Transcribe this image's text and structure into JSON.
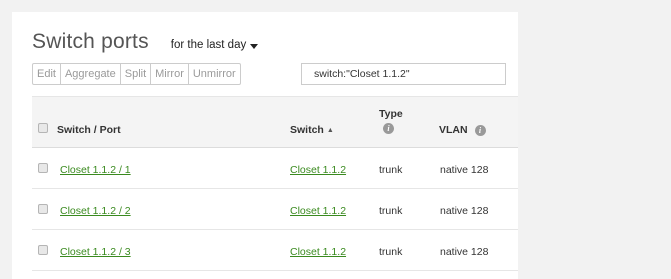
{
  "page": {
    "title": "Switch ports",
    "timespan": "for the last day"
  },
  "toolbar": {
    "buttons": [
      "Edit",
      "Aggregate",
      "Split",
      "Mirror",
      "Unmirror"
    ]
  },
  "search": {
    "value": "switch:\"Closet 1.1.2\""
  },
  "table": {
    "headers": {
      "port": "Switch / Port",
      "switch": "Switch",
      "type": "Type",
      "vlan": "VLAN"
    },
    "rows": [
      {
        "port": "Closet 1.1.2 / 1",
        "switch": "Closet 1.1.2",
        "type": "trunk",
        "vlan": "native 128"
      },
      {
        "port": "Closet 1.1.2 / 2",
        "switch": "Closet 1.1.2",
        "type": "trunk",
        "vlan": "native 128"
      },
      {
        "port": "Closet 1.1.2 / 3",
        "switch": "Closet 1.1.2",
        "type": "trunk",
        "vlan": "native 128"
      }
    ]
  },
  "icons": {
    "info": "info-icon",
    "sort": "sort-ascending-icon",
    "dropdown": "chevron-down-icon"
  },
  "colors": {
    "link": "#3a8a1f",
    "background": "#f2f2f2",
    "header": "#f4f4f4"
  }
}
